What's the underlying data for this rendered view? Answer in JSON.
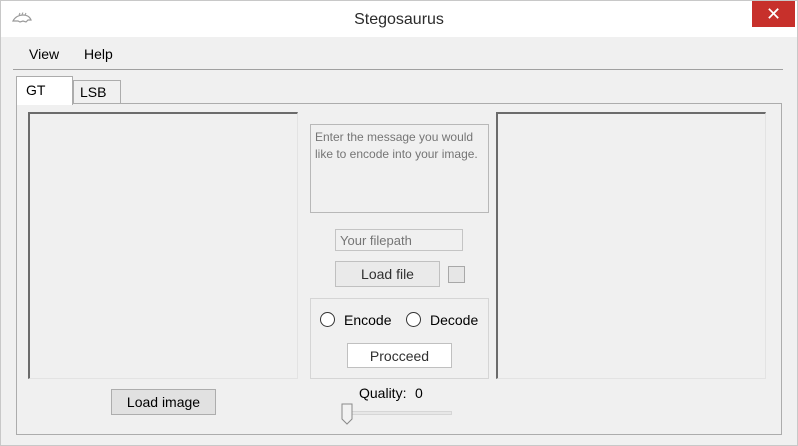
{
  "window": {
    "title": "Stegosaurus",
    "close_glyph": "✕",
    "icon": "stegosaurus-app-icon",
    "close_color": "#c7302b"
  },
  "menu": {
    "items": [
      {
        "label": "View"
      },
      {
        "label": "Help"
      }
    ]
  },
  "tabs": [
    {
      "label": "GT",
      "active": true
    },
    {
      "label": "LSB",
      "active": false
    }
  ],
  "gt": {
    "message_placeholder": "Enter the message you would like to encode into your image.",
    "filepath_placeholder": "Your filepath",
    "load_file_label": "Load file",
    "load_image_label": "Load image",
    "encode_label": "Encode",
    "decode_label": "Decode",
    "proceed_label": "Procceed",
    "quality_label": "Quality:",
    "quality_value": "0",
    "checkbox_checked": false,
    "encode_selected": false,
    "decode_selected": false
  }
}
